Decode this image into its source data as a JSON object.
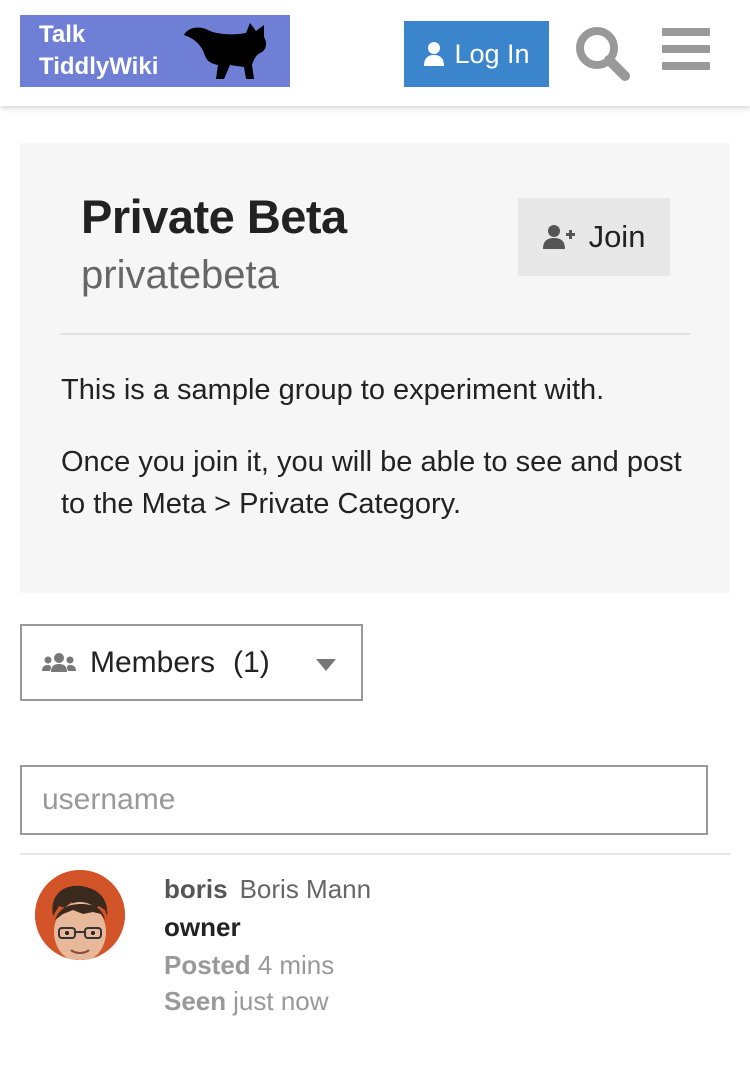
{
  "header": {
    "logo_line1": "Talk",
    "logo_line2": "TiddlyWiki",
    "login_label": "Log In",
    "icons": {
      "login": "user-icon",
      "search": "search-icon",
      "menu": "hamburger-menu-icon"
    }
  },
  "group": {
    "title": "Private Beta",
    "slug": "privatebeta",
    "join_label": "Join",
    "bio": [
      "This is a sample group to experiment with.",
      "Once you join it, you will be able to see and post to the Meta > Private Category."
    ]
  },
  "members_dropdown": {
    "label": "Members",
    "count": "(1)"
  },
  "search": {
    "placeholder": "username",
    "value": ""
  },
  "members": [
    {
      "username": "boris",
      "full_name": "Boris Mann",
      "title": "owner",
      "posted_label": "Posted",
      "posted_value": "4 mins",
      "seen_label": "Seen",
      "seen_value": "just now"
    }
  ],
  "colors": {
    "brand": "#6f7fd6",
    "primary_button": "#3a85cc",
    "card_background": "#f6f6f6",
    "avatar_background": "#d4542a"
  }
}
